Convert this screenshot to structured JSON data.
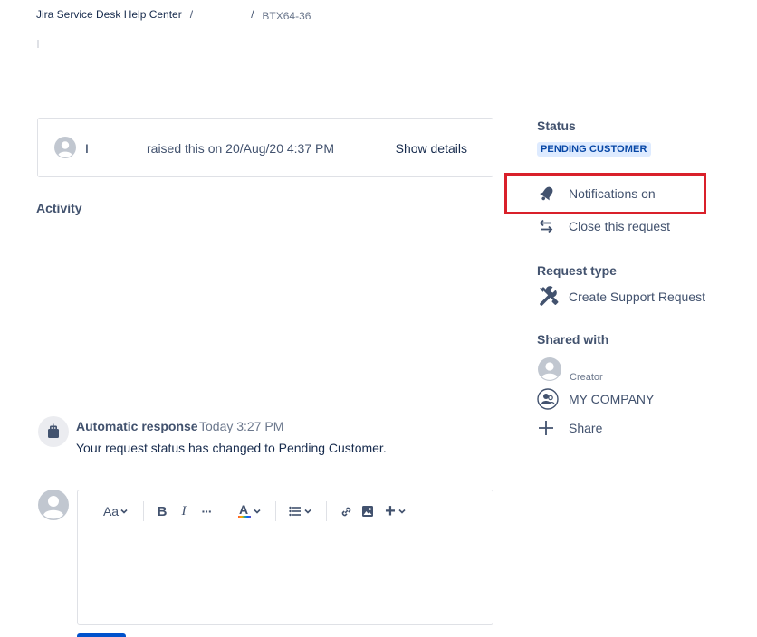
{
  "breadcrumb": {
    "root": "Jira Service Desk Help Center",
    "sep1": "/",
    "project": "",
    "sep2": "/",
    "request_key": "BTX64-36"
  },
  "raised": {
    "reporter": "I",
    "text": "raised this on 20/Aug/20 4:37 PM",
    "show_details": "Show details"
  },
  "activity": {
    "heading": "Activity",
    "items": [
      {
        "author": "Automatic response",
        "time": "Today 3:27 PM",
        "message": "Your request status has changed to Pending Customer."
      }
    ]
  },
  "editor": {
    "toolbar": {
      "text_style": "Aa",
      "bold": "B",
      "italic": "I",
      "more": "···",
      "text_color": "A",
      "list_icon": "bullet-list-icon",
      "link_icon": "link-icon",
      "image_icon": "image-icon",
      "insert": "+"
    }
  },
  "sidebar": {
    "status_label": "Status",
    "status_value": "PENDING CUSTOMER",
    "actions": [
      {
        "label": "Notifications on",
        "icon": "bell-icon"
      },
      {
        "label": "Close this request",
        "icon": "transition-arrows-icon"
      }
    ],
    "request_type_label": "Request type",
    "request_type_value": "Create Support Request",
    "shared_with_label": "Shared with",
    "shared_with": [
      {
        "name": "",
        "role": "Creator"
      },
      {
        "name": "MY COMPANY",
        "role": ""
      }
    ],
    "share_label": "Share"
  },
  "colors": {
    "text_primary": "#172b4d",
    "text_secondary": "#42526e",
    "lozenge_bg": "#deebff",
    "lozenge_text": "#0747a6",
    "highlight": "#d9202a",
    "border": "#dfe1e6"
  }
}
